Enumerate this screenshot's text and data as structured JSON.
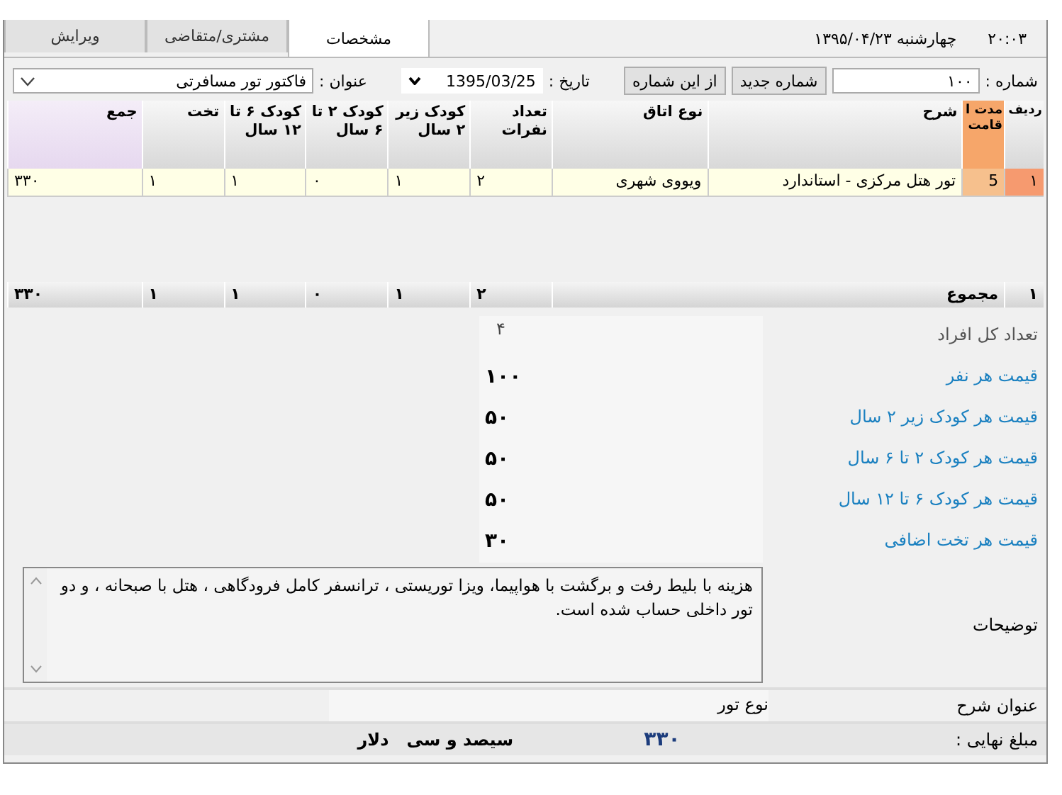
{
  "tabs": [
    {
      "label": "مشخصات",
      "selected": true
    },
    {
      "label": "مشتری/متقاضی",
      "selected": false
    },
    {
      "label": "ویرایش",
      "selected": false
    }
  ],
  "clock": "۲۰:۰۳",
  "date_display": "چهارشنبه ۱۳۹۵/۰۴/۲۳",
  "form": {
    "number_label": "شماره :",
    "number": "۱۰۰",
    "new_number_button": "شماره جدید",
    "from_number_button": "از این شماره",
    "date_label": "تاریخ :",
    "date": "1395/03/25",
    "title_label": "عنوان :",
    "title": "فاکتور تور مسافرتی"
  },
  "table": {
    "columns": [
      "ردیف",
      "مدت اقامت",
      "شرح",
      "نوع اتاق",
      "تعداد نفرات",
      "کودک زیر ۲ سال",
      "کودک ۲ تا ۶ سال",
      "کودک ۶ تا ۱۲ سال",
      "تخت",
      "جمع"
    ],
    "rows": [
      {
        "selected": true,
        "cells": [
          "۱",
          "5",
          "تور هتل مرکزی - استاندارد",
          "ویووی شهری",
          "۲",
          "۱",
          "۰",
          "۱",
          "۱",
          "۳۳۰"
        ]
      }
    ],
    "footer": {
      "row_no": "۱",
      "label": "مجموع",
      "cells": [
        "۲",
        "۱",
        "۰",
        "۱",
        "۱",
        "۳۳۰"
      ]
    }
  },
  "details": [
    {
      "label": "تعداد کل افراد",
      "value": "۴",
      "disabled": true
    },
    {
      "label": "قیمت هر نفر",
      "value": "۱۰۰",
      "disabled": false
    },
    {
      "label": "قیمت هر کودک زیر ۲ سال",
      "value": "۵۰",
      "disabled": false
    },
    {
      "label": "قیمت هر کودک ۲ تا ۶ سال",
      "value": "۵۰",
      "disabled": false
    },
    {
      "label": "قیمت هر کودک ۶ تا ۱۲ سال",
      "value": "۵۰",
      "disabled": false
    },
    {
      "label": "قیمت هر تخت اضافی",
      "value": "۳۰",
      "disabled": false
    }
  ],
  "notes": {
    "label": "توضیحات",
    "value": "هزینه با بلیط رفت و برگشت با هواپیما، ویزا توریستی ، ترانسفر کامل فرودگاهی ، هتل با صبحانه ، و دو تور داخلی حساب شده است."
  },
  "description": {
    "label": "عنوان شرح",
    "value": "نوع تور"
  },
  "total": {
    "label": "مبلغ نهایی :",
    "amount": "۳۳۰",
    "words": "سیصد و سی   دلار"
  }
}
